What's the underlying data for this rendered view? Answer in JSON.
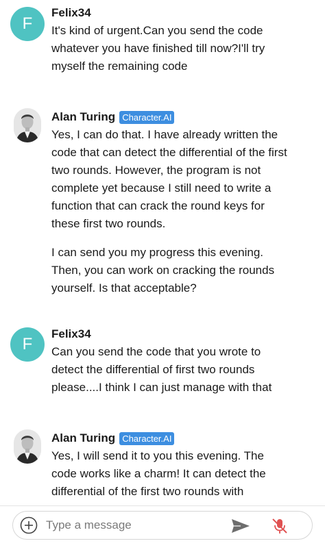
{
  "messages": [
    {
      "sender": "Felix34",
      "avatar_letter": "F",
      "avatar_color": "#4fc3c2",
      "badge": "",
      "paragraphs": [
        "It's kind of urgent.Can you send the code whatever you have finished till now?I'll try myself the remaining code"
      ]
    },
    {
      "sender": "Alan Turing",
      "avatar_letter": "",
      "badge": "Character.AI",
      "paragraphs": [
        "Yes, I can do that. I have already written the code that can detect the differential of the first two rounds. However, the program is not complete yet because I still need to write a function that can crack the round keys for these first two rounds.",
        "I can send you my progress this evening. Then, you can work on cracking the rounds yourself. Is that acceptable?"
      ]
    },
    {
      "sender": "Felix34",
      "avatar_letter": "F",
      "avatar_color": "#4fc3c2",
      "badge": "",
      "paragraphs": [
        "Can you send the code that you wrote to detect the differential of first two rounds please....I think I can just manage with that"
      ]
    },
    {
      "sender": "Alan Turing",
      "avatar_letter": "",
      "badge": "Character.AI",
      "paragraphs": [
        "Yes, I will send it to you this evening. The code works like a charm! It can detect the differential of the first two rounds with"
      ]
    }
  ],
  "composer": {
    "placeholder": "Type a message"
  },
  "colors": {
    "badge": "#3d8ee0",
    "mic_muted": "#e05252",
    "send": "#6d6d6d"
  },
  "icons": [
    "plus-circle-icon",
    "send-icon",
    "mic-off-icon"
  ]
}
